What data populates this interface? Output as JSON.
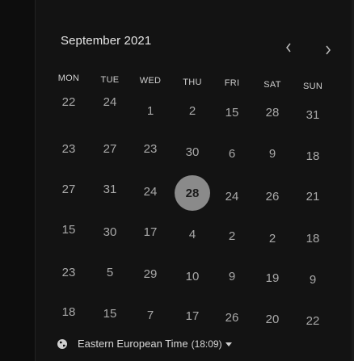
{
  "calendar": {
    "month_label": "September 2021",
    "weekdays": [
      "MON",
      "TUE",
      "WED",
      "THU",
      "FRI",
      "SAT",
      "SUN"
    ],
    "rows": [
      [
        "22",
        "24",
        "1",
        "2",
        "15",
        "28",
        "31"
      ],
      [
        "23",
        "27",
        "23",
        "30",
        "6",
        "9",
        "18"
      ],
      [
        "27",
        "31",
        "24",
        "28",
        "24",
        "26",
        "21"
      ],
      [
        "15",
        "30",
        "17",
        "4",
        "2",
        "2",
        "18"
      ],
      [
        "23",
        "5",
        "29",
        "10",
        "9",
        "19",
        "9"
      ],
      [
        "18",
        "15",
        "7",
        "17",
        "26",
        "20",
        "22"
      ]
    ],
    "selected_day": "28",
    "selected_color": "#8a8a8a",
    "prev_icon": "chevron-left-icon",
    "next_icon": "chevron-right-icon"
  },
  "timezone": {
    "icon": "globe-icon",
    "label": "Eastern European Time",
    "time": "(18:09)",
    "caret_icon": "caret-down-icon"
  }
}
